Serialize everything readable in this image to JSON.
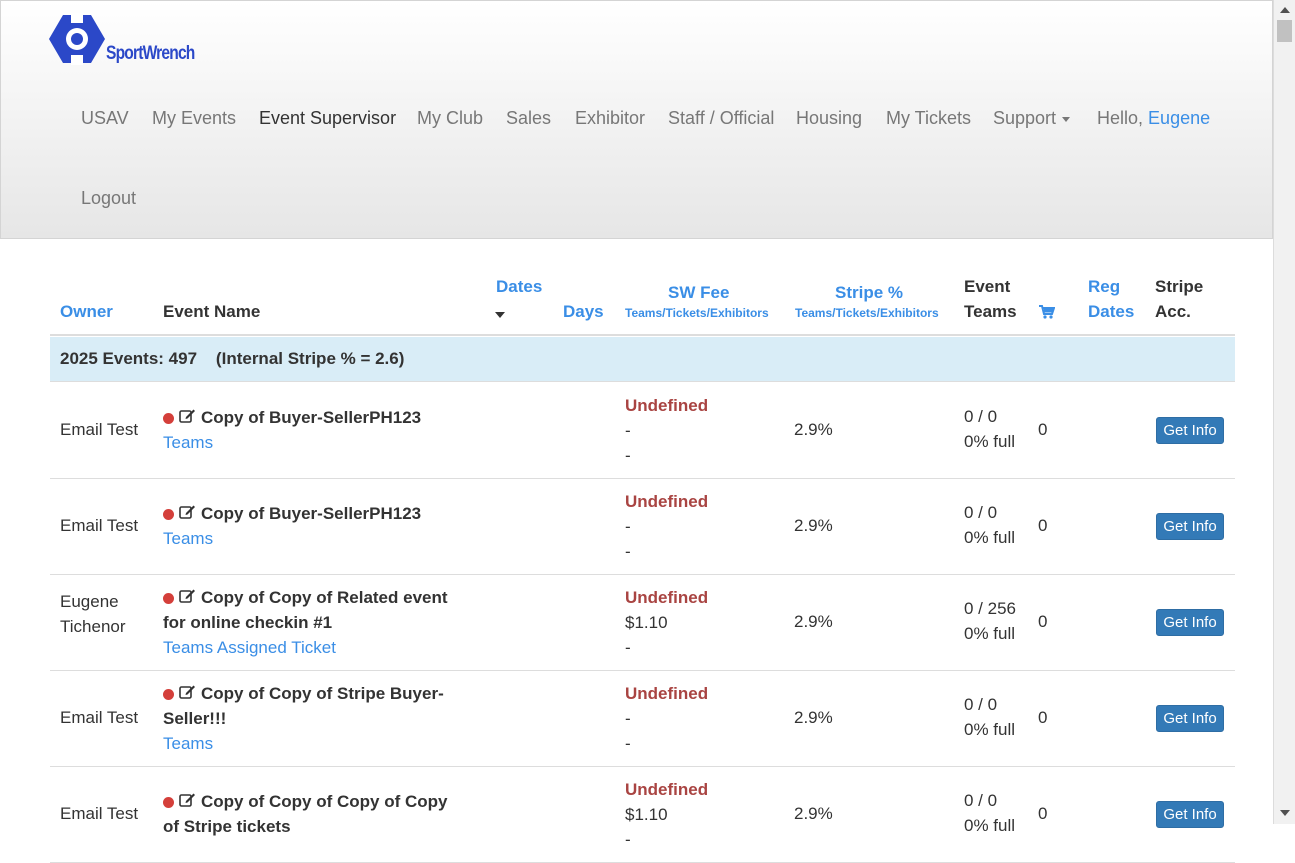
{
  "brand": {
    "logo_text": "SportWrench",
    "color": "#2b48c8"
  },
  "nav": {
    "items": [
      {
        "label": "USAV"
      },
      {
        "label": "My Events"
      },
      {
        "label": "Event Supervisor"
      },
      {
        "label": "My Club"
      },
      {
        "label": "Sales"
      },
      {
        "label": "Exhibitor"
      },
      {
        "label": "Staff / Official"
      },
      {
        "label": "Housing"
      },
      {
        "label": "My Tickets"
      },
      {
        "label": "Support"
      }
    ],
    "active": "Event Supervisor",
    "hello_prefix": "Hello,",
    "user_name": "Eugene",
    "logout": "Logout"
  },
  "table": {
    "headers": {
      "owner": "Owner",
      "event_name": "Event Name",
      "dates": "Dates",
      "days": "Days",
      "sw_fee": "SW Fee",
      "sw_fee_sub": "Teams/Tickets/Exhibitors",
      "stripe_pct": "Stripe %",
      "stripe_pct_sub": "Teams/Tickets/Exhibitors",
      "event_teams_1": "Event",
      "event_teams_2": "Teams",
      "reg_dates_1": "Reg",
      "reg_dates_2": "Dates",
      "stripe_acc_1": "Stripe",
      "stripe_acc_2": "Acc."
    },
    "group_label": "2025 Events: 497    (Internal Stripe % = 2.6)",
    "rows": [
      {
        "owner": [
          "Email Test"
        ],
        "event": [
          "Copy of Buyer-SellerPH123"
        ],
        "link": "Teams",
        "fee": [
          "Undefined",
          "-",
          "-"
        ],
        "stripe": "2.9%",
        "teams": [
          "0 / 0",
          "0% full"
        ],
        "cart": "0",
        "button": "Get Info"
      },
      {
        "owner": [
          "Email Test"
        ],
        "event": [
          "Copy of Buyer-SellerPH123"
        ],
        "link": "Teams",
        "fee": [
          "Undefined",
          "-",
          "-"
        ],
        "stripe": "2.9%",
        "teams": [
          "0 / 0",
          "0% full"
        ],
        "cart": "0",
        "button": "Get Info"
      },
      {
        "owner": [
          "Eugene",
          "Tichenor"
        ],
        "event": [
          "Copy of Copy of Related event",
          "for online checkin #1"
        ],
        "link": "Teams Assigned Ticket",
        "fee": [
          "Undefined",
          "$1.10",
          "-"
        ],
        "stripe": "2.9%",
        "teams": [
          "0 / 256",
          "0% full"
        ],
        "cart": "0",
        "button": "Get Info"
      },
      {
        "owner": [
          "Email Test"
        ],
        "event": [
          "Copy of Copy of Stripe Buyer-",
          "Seller!!!"
        ],
        "link": "Teams",
        "fee": [
          "Undefined",
          "-",
          "-"
        ],
        "stripe": "2.9%",
        "teams": [
          "0 / 0",
          "0% full"
        ],
        "cart": "0",
        "button": "Get Info"
      },
      {
        "owner": [
          "Email Test"
        ],
        "event": [
          "Copy of Copy of Copy of Copy",
          "of Stripe tickets"
        ],
        "link": "",
        "fee": [
          "Undefined",
          "$1.10",
          "-"
        ],
        "stripe": "2.9%",
        "teams": [
          "0 / 0",
          "0% full"
        ],
        "cart": "0",
        "button": "Get Info"
      }
    ]
  },
  "colors": {
    "link": "#3a8ee6",
    "undefined": "#a94442",
    "status_dot": "#d43f3a",
    "button": "#337ab7",
    "group_row": "#d9edf7"
  },
  "icons": {
    "status": "red-dot-icon",
    "edit": "edit-icon",
    "cart": "shopping-cart-icon",
    "sort": "sort-down-icon"
  }
}
